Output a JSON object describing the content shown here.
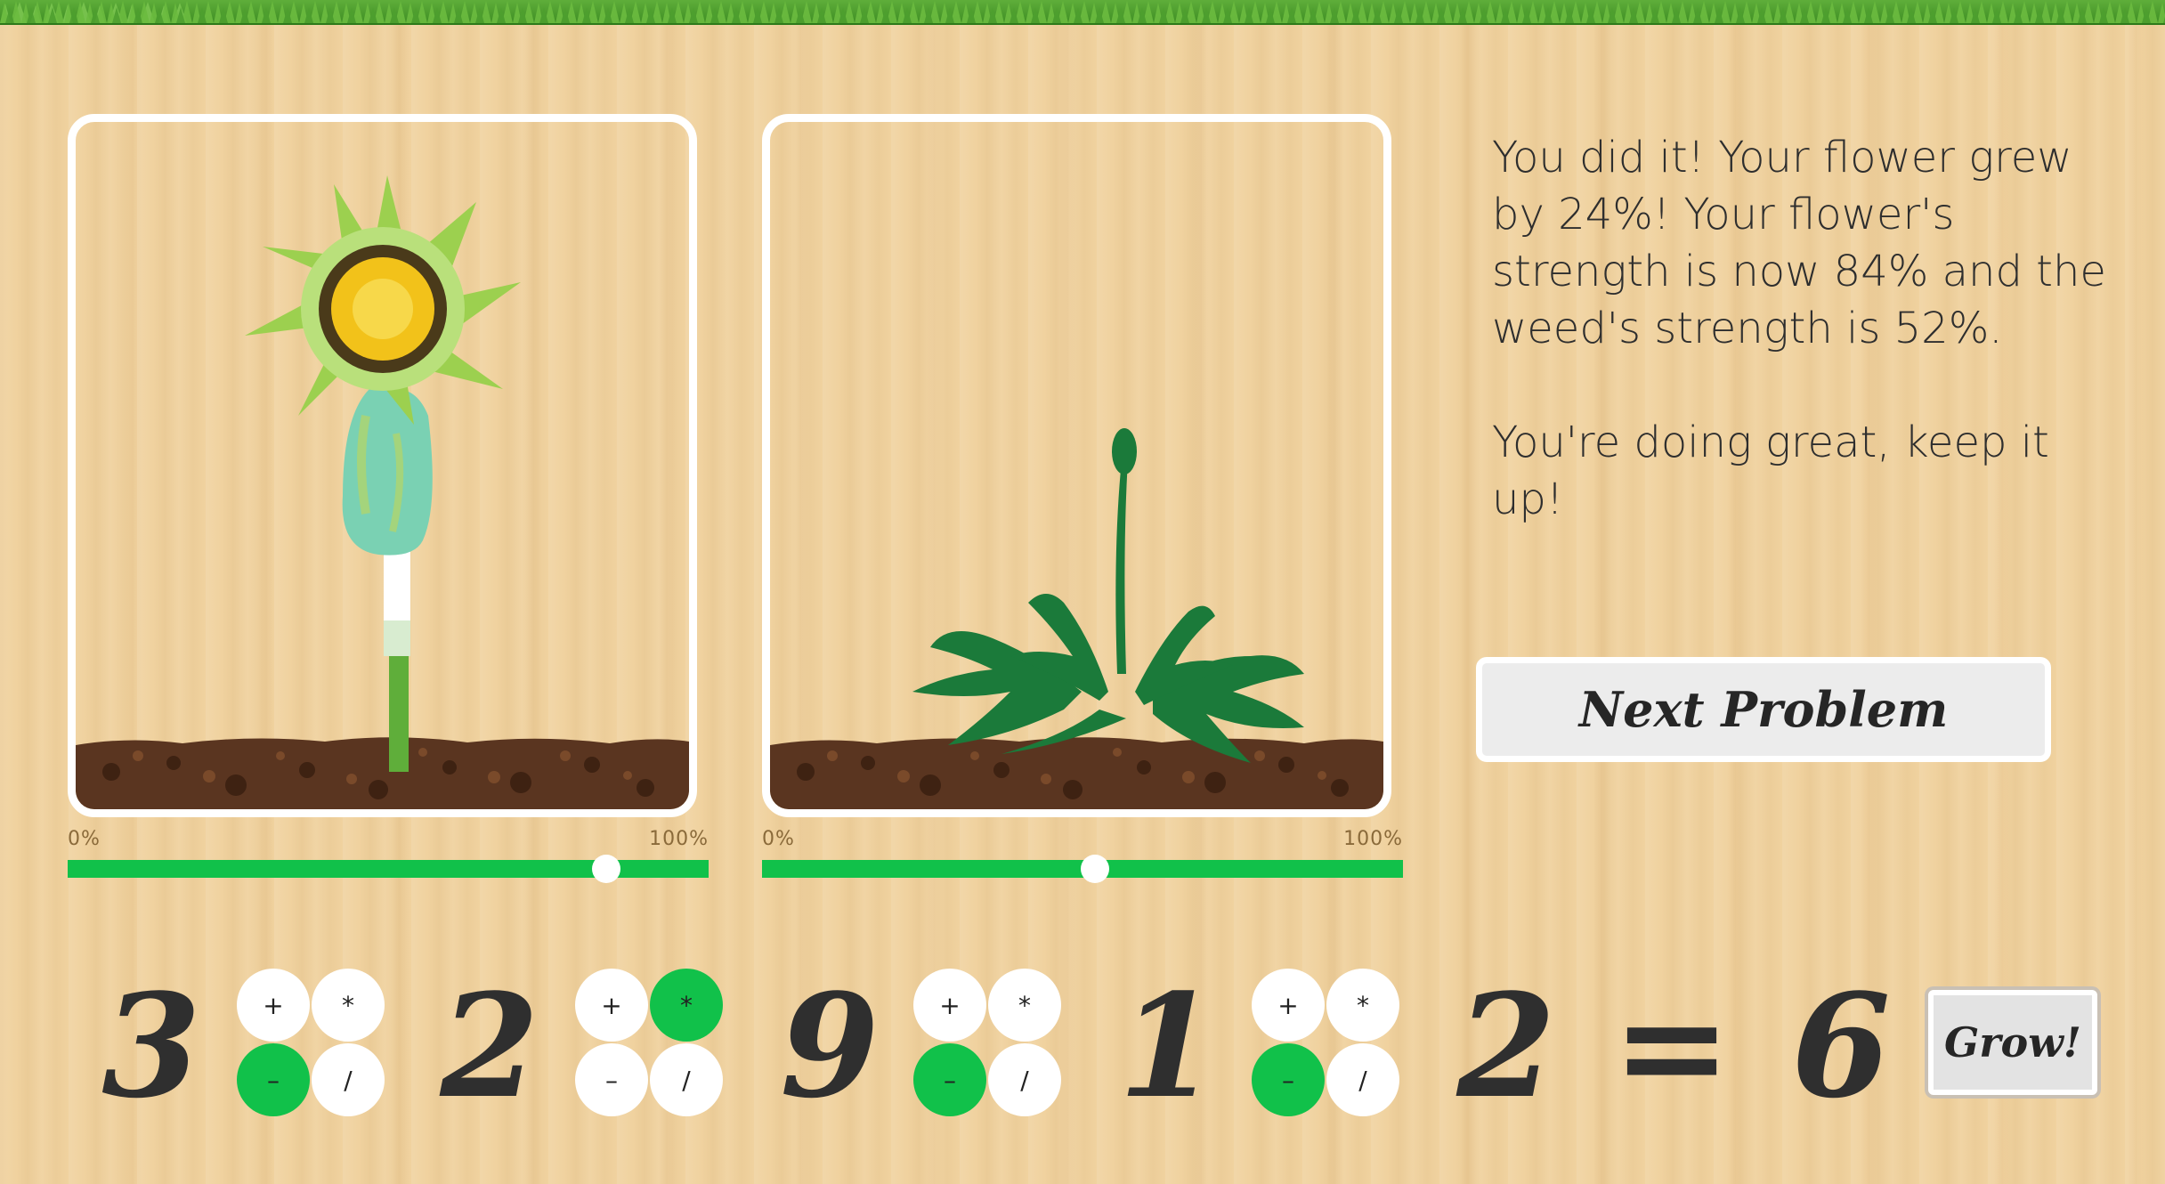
{
  "message": {
    "line1": "You did it! Your flower grew by 24%! Your flower's strength is now 84% and the weed's strength is 52%.",
    "line2": "You're doing great, keep it up!"
  },
  "next_button_label": "Next Problem",
  "grow_button_label": "Grow!",
  "flower_meter": {
    "min_label": "0%",
    "max_label": "100%",
    "value": 0.84
  },
  "weed_meter": {
    "min_label": "0%",
    "max_label": "100%",
    "value": 0.52
  },
  "equation": {
    "numbers": [
      "3",
      "2",
      "9",
      "1",
      "2"
    ],
    "equals": "=",
    "result": "6",
    "operator_labels": {
      "add": "+",
      "multiply": "*",
      "subtract": "–",
      "divide": "/"
    },
    "selected_operators": [
      "subtract",
      "multiply",
      "subtract",
      "subtract"
    ]
  },
  "colors": {
    "accent_green": "#11c14a",
    "text_dark": "#2e2e2e",
    "panel_border": "#ffffff"
  },
  "icons": {
    "flower": "dandelion-flower-icon",
    "weed": "dandelion-weed-icon"
  }
}
